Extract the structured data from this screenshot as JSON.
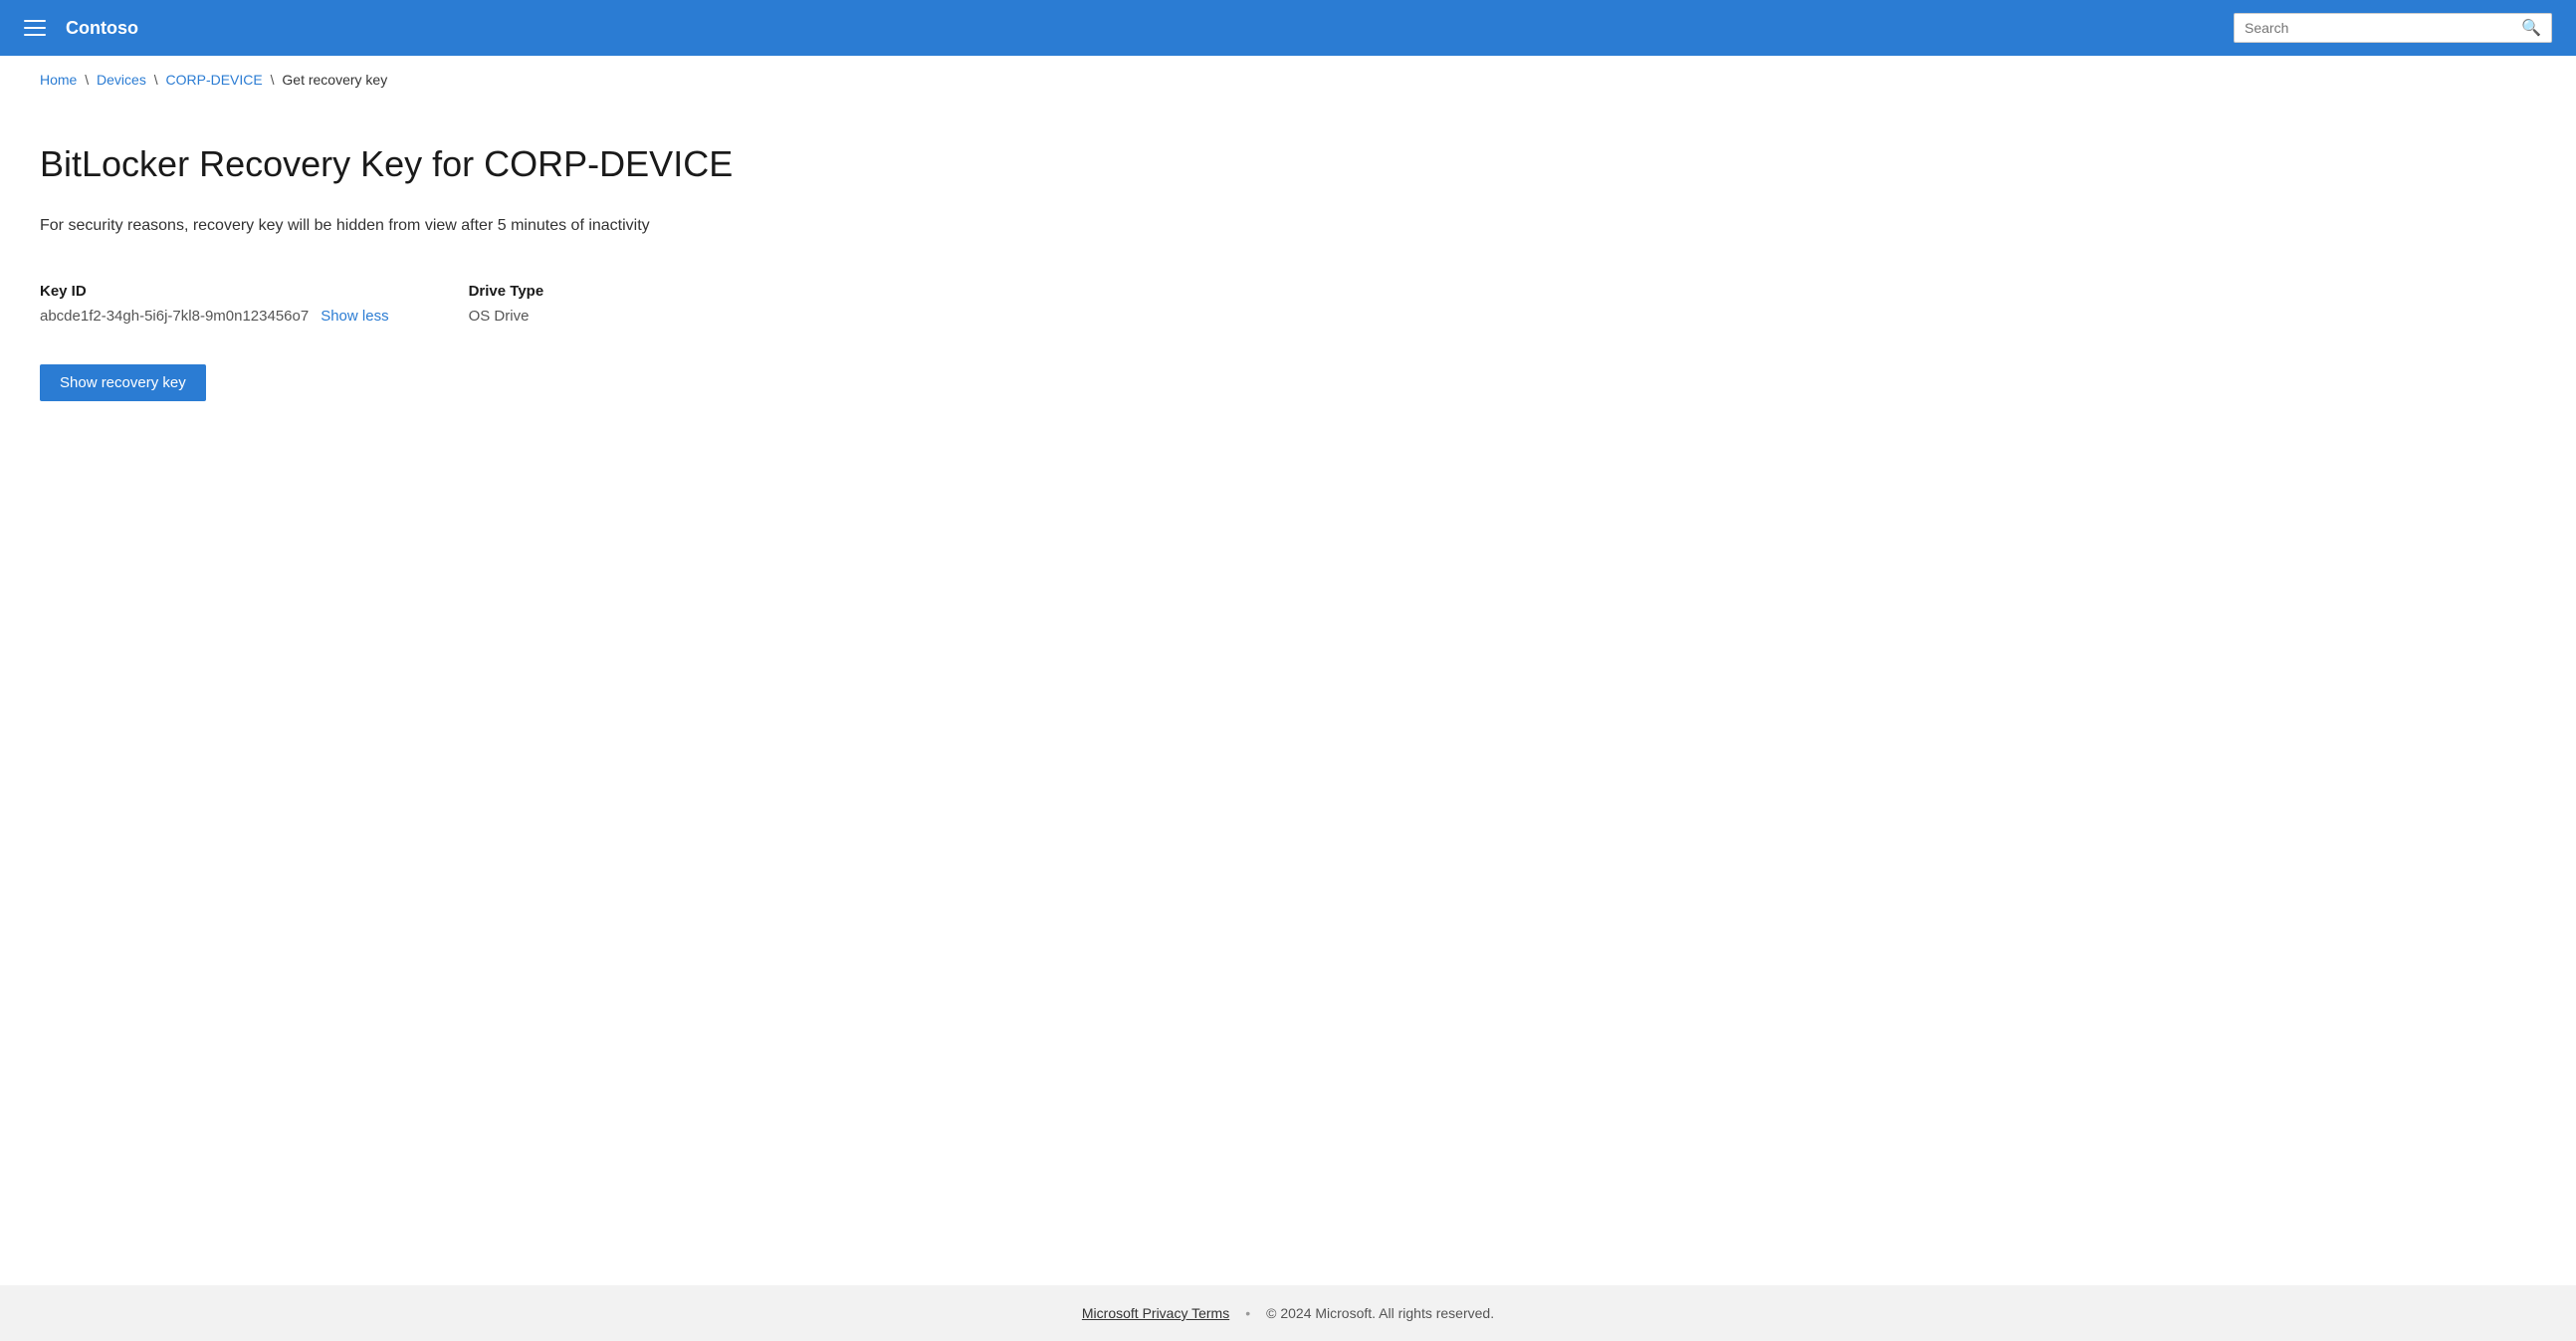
{
  "header": {
    "title": "Contoso",
    "search_placeholder": "Search"
  },
  "breadcrumb": {
    "home": "Home",
    "devices": "Devices",
    "device_name": "CORP-DEVICE",
    "current": "Get recovery key"
  },
  "main": {
    "page_title": "BitLocker Recovery Key for CORP-DEVICE",
    "security_notice": "For security reasons, recovery key will be hidden from view after 5 minutes of inactivity",
    "key_id_label": "Key ID",
    "key_id_value": "abcde1f2-34gh-5i6j-7kl8-9m0n123456o7",
    "show_less_label": "Show less",
    "drive_type_label": "Drive Type",
    "drive_type_value": "OS Drive",
    "show_recovery_key_button": "Show recovery key"
  },
  "footer": {
    "privacy_link": "Microsoft Privacy Terms",
    "copyright": "© 2024 Microsoft. All rights reserved."
  }
}
